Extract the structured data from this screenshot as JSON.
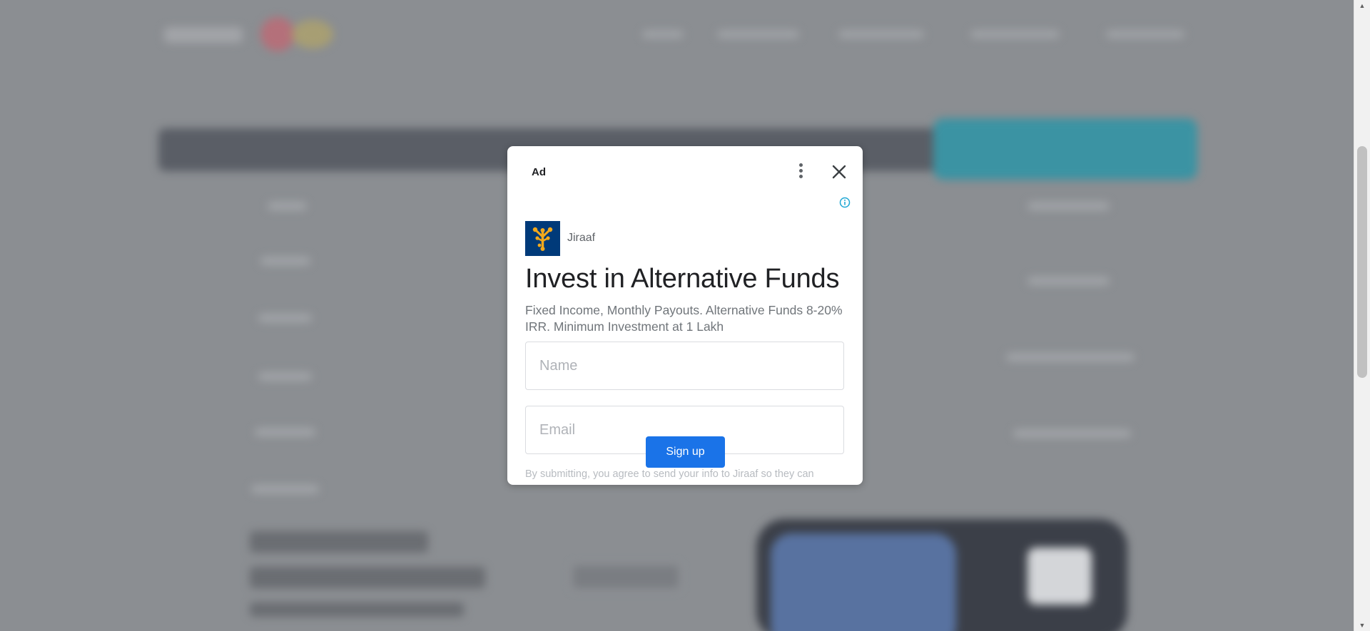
{
  "ad": {
    "label": "Ad",
    "advertiser": "Jiraaf",
    "headline": "Invest in Alternative Funds",
    "description": "Fixed Income, Monthly Payouts. Alternative Funds 8-20% IRR. Minimum Investment at 1 Lakh",
    "name_placeholder": "Name",
    "email_placeholder": "Email",
    "signup_label": "Sign up",
    "disclaimer": "By submitting, you agree to send your info to Jiraaf so they can",
    "icons": {
      "more": "more-vert-icon",
      "close": "close-icon",
      "info": "info-icon",
      "brand": "jiraaf-logo"
    },
    "colors": {
      "accent": "#1a73e8",
      "brand_bg": "#003a79",
      "brand_mark": "#f2a91c",
      "info": "#1ea7d4"
    }
  }
}
